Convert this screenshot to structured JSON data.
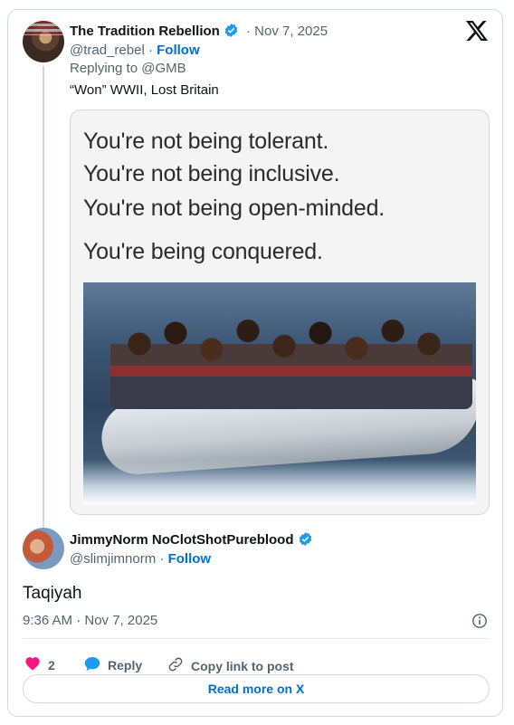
{
  "parent_tweet": {
    "author_name": "The Tradition Rebellion",
    "handle": "@trad_rebel",
    "follow_label": "Follow",
    "date": "· Nov 7, 2025",
    "replying_to": "Replying to @GMB",
    "text": "“Won” WWII, Lost Britain",
    "media": {
      "lines": [
        "You're not being tolerant.",
        "You're not being inclusive.",
        "You're not being open-minded.",
        "You're being conquered."
      ]
    }
  },
  "reply_tweet": {
    "author_name": "JimmyNorm NoClotShotPureblood",
    "handle": "@slimjimnorm",
    "follow_label": "Follow",
    "text": "Taqiyah",
    "timestamp": "9:36 AM · Nov 7, 2025"
  },
  "actions": {
    "like_count": "2",
    "reply_label": "Reply",
    "copy_link_label": "Copy link to post",
    "read_more_label": "Read more on X"
  },
  "colors": {
    "accent": "#006fd6",
    "like": "#f91880",
    "verified": "#1d9bf0",
    "muted": "#536471"
  },
  "icons": [
    "x-logo-icon",
    "verified-badge-icon",
    "heart-icon",
    "reply-bubble-icon",
    "link-icon",
    "info-icon"
  ]
}
